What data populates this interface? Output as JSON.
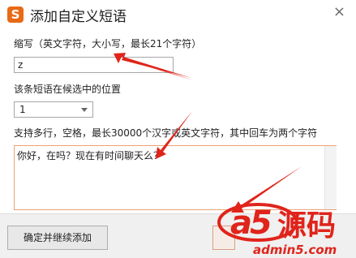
{
  "window": {
    "title": "添加自定义短语",
    "logo_glyph": "S",
    "close_glyph": "×",
    "accent": "#e96a16"
  },
  "abbr": {
    "label": "缩写（英文字符，大小写，最长21个字符）",
    "value": "z"
  },
  "position": {
    "label": "该条短语在候选中的位置",
    "selected": "1"
  },
  "phrase": {
    "label": "支持多行，空格，最长30000个汉字或英文字符，其中回车为两个字符",
    "value": "你好，在吗？现在有时间聊天么？"
  },
  "buttons": {
    "continue_label": "确定并继续添加"
  },
  "watermark": {
    "text": "a5源码",
    "site": "admin5.com"
  }
}
